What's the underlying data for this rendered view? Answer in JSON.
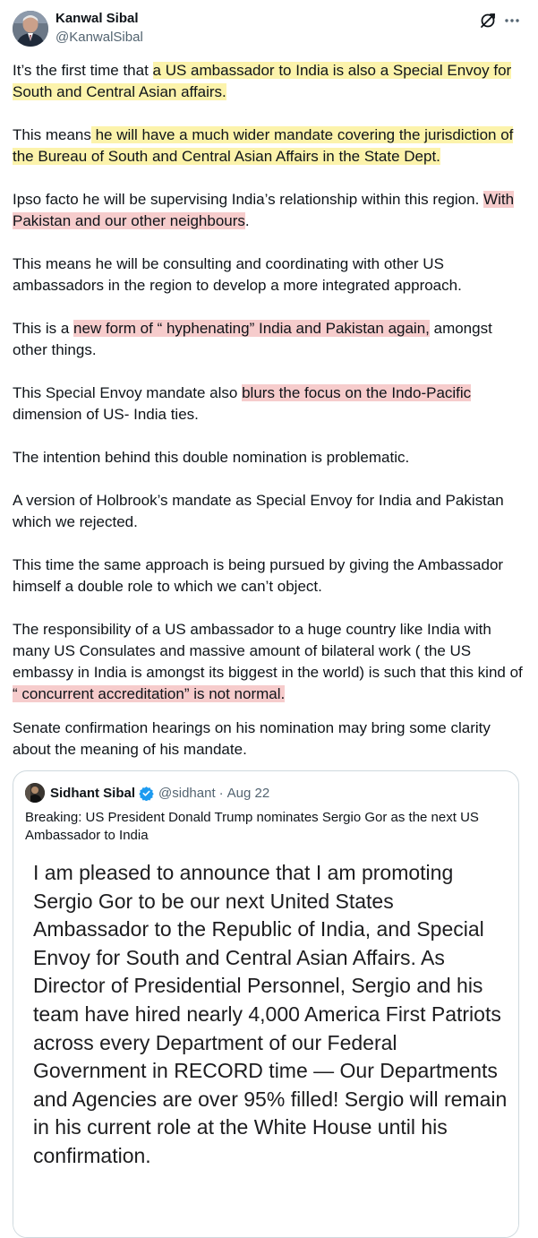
{
  "author": {
    "name": "Kanwal Sibal",
    "handle": "@KanwalSibal"
  },
  "icons": {
    "grok": "grok-icon",
    "more": "more-options-icon",
    "verified": "verified-badge-icon"
  },
  "colors": {
    "highlight_yellow": "#fcf3ab",
    "highlight_red": "#f6cccc",
    "verified_blue": "#1d9bf0"
  },
  "tweet": {
    "p1": {
      "a": "It’s the first time that ",
      "b": "a US ambassador to India is also a Special Envoy for South and Central Asian affairs."
    },
    "p2": {
      "a": "This means",
      "b": " he will have a much wider mandate covering the jurisdiction of the Bureau of South and Central Asian Affairs in the State Dept. "
    },
    "p3": {
      "a": "Ipso facto he will be supervising India’s relationship within this region. ",
      "b": "With Pakistan and our other neighbours",
      "c": "."
    },
    "p4": "This means he will be consulting and coordinating with other US ambassadors in the region to develop a more integrated approach.",
    "p5": {
      "a": "This is a ",
      "b": "new form of “ hyphenating” India and Pakistan again,",
      "c": " amongst other things."
    },
    "p6": {
      "a": "This Special Envoy mandate also ",
      "b": "blurs the focus on the Indo-Pacific ",
      "c": "dimension of US- India ties."
    },
    "p7": "The intention behind this double nomination is problematic.",
    "p8": "A version of Holbrook’s mandate as Special Envoy for India and Pakistan which we rejected.",
    "p9": "This time the same approach is being pursued by giving the Ambassador himself a double role to which we can’t object.",
    "p10": {
      "a": "The responsibility of a US ambassador to a huge country like India with many US Consulates and massive amount of bilateral work ( the US embassy in India is amongst its biggest in the world) is such that this kind of ",
      "b": "“ concurrent accreditation” is not normal."
    },
    "p11": "Senate confirmation hearings on his nomination may bring some clarity about the meaning of his mandate."
  },
  "quote": {
    "name": "Sidhant Sibal",
    "handle": "@sidhant",
    "separator": "·",
    "date": "Aug 22",
    "text": "Breaking: US President Donald Trump nominates Sergio Gor as the next US Ambassador to India",
    "image_text": "I am pleased to announce that I am promoting Sergio Gor to be our next United States Ambassador to the Republic of India, and Special Envoy for South and Central Asian Affairs. As Director of Presidential Personnel, Sergio and his team have hired nearly 4,000 America First Patriots across every Department of our Federal Government in RECORD time — Our Departments and Agencies are over 95% filled! Sergio will remain in his current role at the White House until his confirmation."
  }
}
